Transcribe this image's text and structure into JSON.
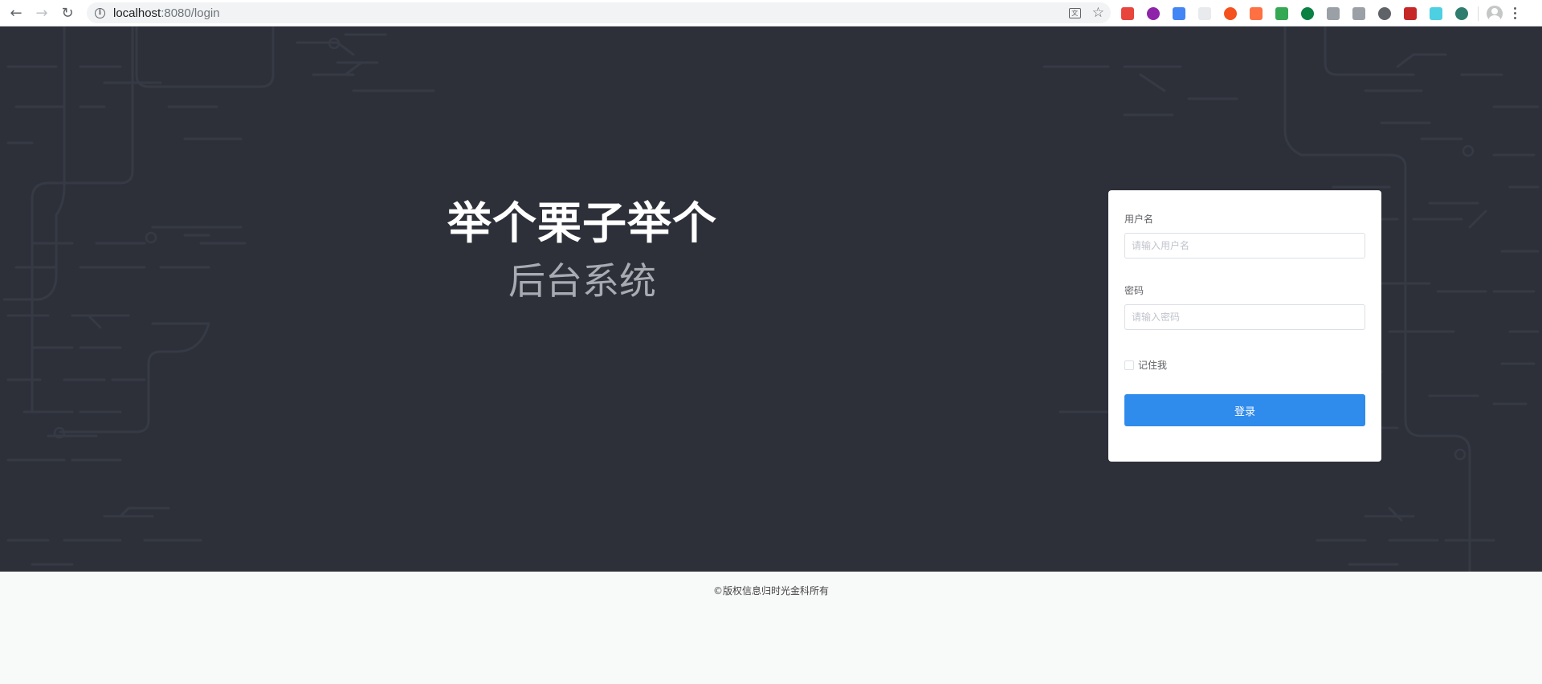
{
  "browser": {
    "url_host": "localhost",
    "url_path": ":8080/login",
    "extensions": [
      {
        "name": "ext-red-icon",
        "color": "#e8453c"
      },
      {
        "name": "ext-purple-icon",
        "color": "#8e24aa"
      },
      {
        "name": "ext-pinwheel-icon",
        "color": "#4285f4"
      },
      {
        "name": "ext-blank-icon",
        "color": "#e8eaed"
      },
      {
        "name": "ext-orange-icon",
        "color": "#f4511e"
      },
      {
        "name": "ext-orange-x-icon",
        "color": "#ff7043"
      },
      {
        "name": "ext-green-cube-icon",
        "color": "#34a853"
      },
      {
        "name": "ext-dark-green-icon",
        "color": "#0b8043"
      },
      {
        "name": "ext-tree-icon",
        "color": "#9aa0a6"
      },
      {
        "name": "ext-filter-icon",
        "color": "#9aa0a6"
      },
      {
        "name": "ext-s-icon",
        "color": "#5f6368"
      },
      {
        "name": "ext-abp-icon",
        "color": "#c62828"
      },
      {
        "name": "ext-fps-icon",
        "color": "#4dd0e1"
      },
      {
        "name": "ext-vue-icon",
        "color": "#2e7d6e"
      }
    ]
  },
  "brand": {
    "title": "举个栗子举个",
    "subtitle": "后台系统"
  },
  "login": {
    "username_label": "用户名",
    "username_placeholder": "请输入用户名",
    "password_label": "密码",
    "password_placeholder": "请输入密码",
    "remember_label": "记住我",
    "submit_label": "登录"
  },
  "footer": {
    "copyright": "©版权信息归时光金科所有"
  },
  "colors": {
    "hero_bg": "#2d3039",
    "primary": "#2f8bec",
    "footer_bg": "#f8f9f9"
  }
}
